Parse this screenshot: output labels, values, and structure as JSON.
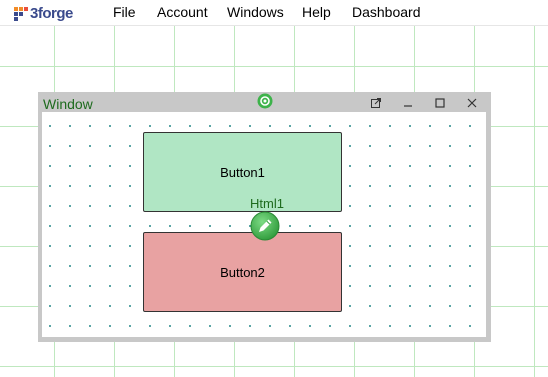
{
  "brand": {
    "name": "3forge"
  },
  "menu": {
    "items": [
      "File",
      "Account",
      "Windows",
      "Help",
      "Dashboard"
    ]
  },
  "window": {
    "title": "Window",
    "components": {
      "button1": {
        "label": "Button1",
        "color": "#b0e6c4"
      },
      "button2": {
        "label": "Button2",
        "color": "#e8a2a2"
      },
      "html1": {
        "label": "Html1"
      }
    }
  },
  "colors": {
    "grid": "#bfe8bf",
    "window_title": "#1e6b1e",
    "accent_green": "#3db34a"
  },
  "icons": {
    "window_center": "green-gear-icon",
    "popout": "popout-icon",
    "minimize": "minimize-icon",
    "maximize": "maximize-icon",
    "close": "close-icon",
    "edit": "pencil-icon"
  }
}
